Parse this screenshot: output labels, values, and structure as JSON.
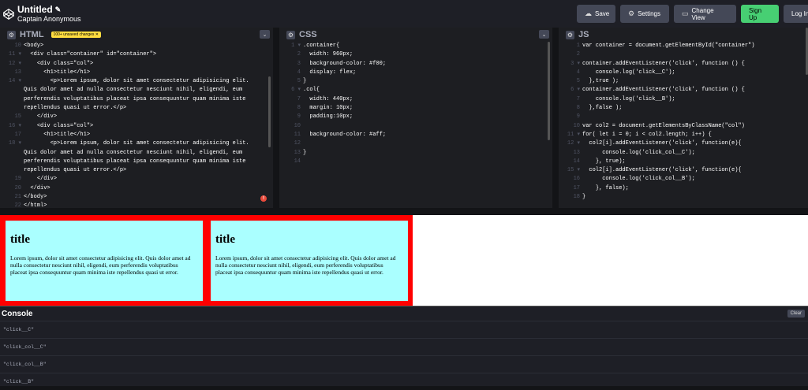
{
  "header": {
    "title": "Untitled",
    "author": "Captain Anonymous",
    "buttons": {
      "save": "Save",
      "settings": "Settings",
      "change_view": "Change View",
      "signup": "Sign Up",
      "login": "Log In"
    }
  },
  "html_panel": {
    "name": "HTML",
    "badge": "100+ unsaved changes ✕",
    "lines": [
      {
        "n": "10",
        "t": "<body>"
      },
      {
        "n": "11 ▾",
        "t": "  <div class=\"container\" id=\"container\">"
      },
      {
        "n": "12 ▾",
        "t": "    <div class=\"col\">"
      },
      {
        "n": "13",
        "t": "      <h1>title</h1>"
      },
      {
        "n": "14 ▾",
        "t": "        <p>Lorem ipsum, dolor sit amet consectetur adipisicing elit. Quis dolor amet ad nulla consectetur nesciunt nihil, eligendi, eum perferendis voluptatibus placeat ipsa consequuntur quam minima iste repellendus quasi ut error.</p>"
      },
      {
        "n": "15",
        "t": "    </div>"
      },
      {
        "n": "16 ▾",
        "t": "    <div class=\"col\">"
      },
      {
        "n": "17",
        "t": "      <h1>title</h1>"
      },
      {
        "n": "18 ▾",
        "t": "        <p>Lorem ipsum, dolor sit amet consectetur adipisicing elit. Quis dolor amet ad nulla consectetur nesciunt nihil, eligendi, eum perferendis voluptatibus placeat ipsa consequuntur quam minima iste repellendus quasi ut error.</p>"
      },
      {
        "n": "19",
        "t": "    </div>"
      },
      {
        "n": "20",
        "t": "  </div>"
      },
      {
        "n": "21",
        "t": "</body>"
      },
      {
        "n": "22",
        "t": "</html>"
      }
    ]
  },
  "css_panel": {
    "name": "CSS",
    "lines": [
      {
        "n": "1 ▾",
        "t": ".container{"
      },
      {
        "n": "2",
        "t": "  width: 960px;"
      },
      {
        "n": "3",
        "t": "  background-color: #f00;"
      },
      {
        "n": "4",
        "t": "  display: flex;"
      },
      {
        "n": "5",
        "t": "}"
      },
      {
        "n": "6 ▾",
        "t": ".col{"
      },
      {
        "n": "7",
        "t": "  width: 440px;"
      },
      {
        "n": "8",
        "t": "  margin: 10px;"
      },
      {
        "n": "9",
        "t": "  padding:10px;"
      },
      {
        "n": "10",
        "t": ""
      },
      {
        "n": "11",
        "t": "  background-color: #aff;"
      },
      {
        "n": "12",
        "t": ""
      },
      {
        "n": "13",
        "t": "}"
      },
      {
        "n": "14",
        "t": ""
      }
    ]
  },
  "js_panel": {
    "name": "JS",
    "lines": [
      {
        "n": "1",
        "t": "var container = document.getElementById(\"container\")"
      },
      {
        "n": "2",
        "t": ""
      },
      {
        "n": "3 ▾",
        "t": "container.addEventListener('click', function () {"
      },
      {
        "n": "4",
        "t": "    console.log('click__C');"
      },
      {
        "n": "5",
        "t": "  },true );"
      },
      {
        "n": "6 ▾",
        "t": "container.addEventListener('click', function () {"
      },
      {
        "n": "7",
        "t": "    console.log('click__B');"
      },
      {
        "n": "8",
        "t": "  },false );"
      },
      {
        "n": "9",
        "t": ""
      },
      {
        "n": "10",
        "t": "var col2 = document.getElementsByClassName(\"col\")"
      },
      {
        "n": "11 ▾",
        "t": "for( let i = 0; i < col2.length; i++) {"
      },
      {
        "n": "12 ▾",
        "t": "  col2[i].addEventListener('click', function(e){"
      },
      {
        "n": "13",
        "t": "      console.log('click_col__C');"
      },
      {
        "n": "14",
        "t": "    }, true);"
      },
      {
        "n": "15 ▾",
        "t": "  col2[i].addEventListener('click', function(e){"
      },
      {
        "n": "16",
        "t": "      console.log('click_col__B');"
      },
      {
        "n": "17",
        "t": "    }, false);"
      },
      {
        "n": "18",
        "t": "}"
      }
    ]
  },
  "preview": {
    "cols": [
      {
        "title": "title",
        "text": "Lorem ipsum, dolor sit amet consectetur adipisicing elit. Quis dolor amet ad nulla consectetur nesciunt nihil, eligendi, eum perferendis voluptatibus placeat ipsa consequuntur quam minima iste repellendus quasi ut error."
      },
      {
        "title": "title",
        "text": "Lorem ipsum, dolor sit amet consectetur adipisicing elit. Quis dolor amet ad nulla consectetur nesciunt nihil, eligendi, eum perferendis voluptatibus placeat ipsa consequuntur quam minima iste repellendus quasi ut error."
      }
    ]
  },
  "console": {
    "title": "Console",
    "clear": "Clear",
    "logs": [
      "\"click__C\"",
      "\"click_col__C\"",
      "\"click_col__B\"",
      "\"click__B\""
    ]
  },
  "colors": {
    "signup": "#47cf73",
    "container_bg": "#f00",
    "col_bg": "#aff",
    "badge": "#ffdd40"
  }
}
